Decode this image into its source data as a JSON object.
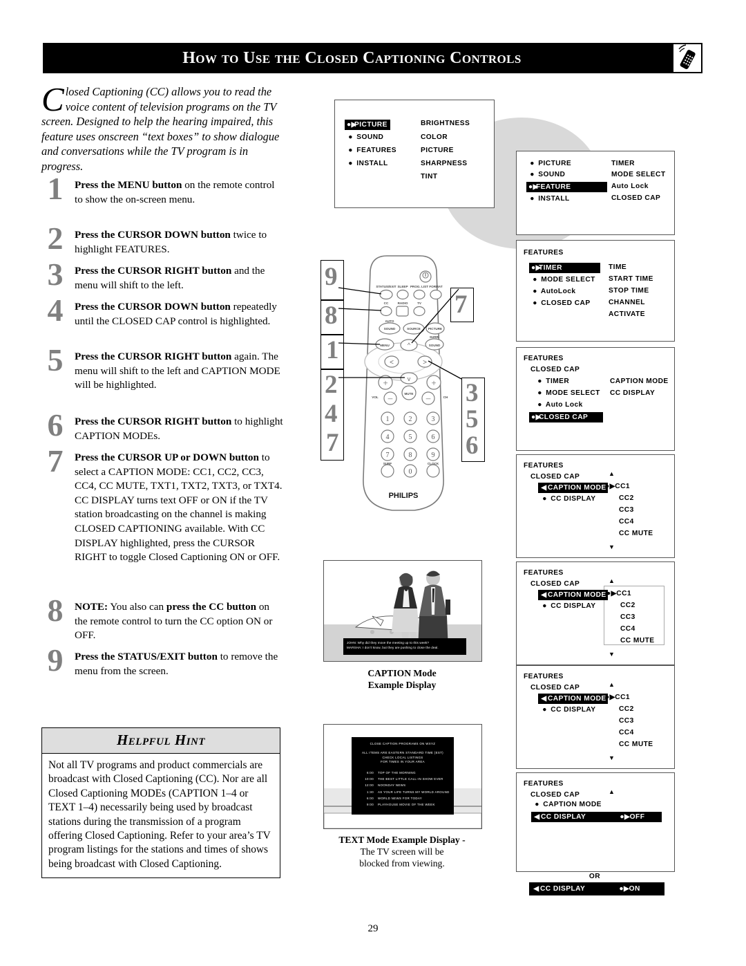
{
  "header": {
    "title": "How to Use the Closed Captioning Controls",
    "icon": "remote-control-icon"
  },
  "intro": {
    "dropcap": "C",
    "text": "losed Captioning (CC) allows you to read the voice content of television programs on the TV screen.  Designed to help the hearing impaired, this feature uses onscreen “text boxes” to show dialogue and conversations while the TV program is in progress."
  },
  "steps": [
    {
      "num": "1",
      "bold": "Press the MENU button",
      "rest": " on the remote control to show the on-screen menu."
    },
    {
      "num": "2",
      "bold": "Press the CURSOR DOWN button",
      "rest": " twice to highlight FEATURES."
    },
    {
      "num": "3",
      "bold": "Press the CURSOR RIGHT button",
      "rest": " and the menu will shift to the left."
    },
    {
      "num": "4",
      "bold": "Press the CURSOR DOWN button",
      "rest": " repeatedly until the CLOSED CAP control is highlighted."
    },
    {
      "num": "5",
      "bold": "Press the CURSOR RIGHT button",
      "rest": " again. The menu will shift to the left and CAPTION MODE will be highlighted."
    },
    {
      "num": "6",
      "bold": "Press the CURSOR RIGHT button",
      "rest": " to highlight CAPTION MODEs."
    },
    {
      "num": "7",
      "bold": "Press the CURSOR UP or DOWN button",
      "rest": " to select a CAPTION MODE: CC1, CC2, CC3, CC4, CC MUTE, TXT1, TXT2, TXT3, or TXT4.  CC DISPLAY turns text OFF or ON if the TV station broadcasting on the channel is making CLOSED CAPTIONING available. With CC DISPLAY highlighted, press the CURSOR RIGHT to toggle Closed Captioning ON or OFF."
    },
    {
      "num": "8",
      "bold": "NOTE:",
      "rest": " You also can ",
      "bold2": "press the CC button",
      "rest2": " on the remote control to turn the CC option ON or OFF."
    },
    {
      "num": "9",
      "bold": "Press the STATUS/EXIT button",
      "rest": " to remove the menu from the screen."
    }
  ],
  "hint": {
    "heading": "Helpful Hint",
    "body": "Not all TV programs and product commercials are broadcast with Closed Captioning (CC).  Nor are all Closed Captioning MODEs (CAPTION 1–4 or TEXT 1–4) necessarily being used by broadcast stations during the transmission of a program offering Closed Captioning.  Refer to your area’s TV program listings for the stations and times of shows being broadcast with Closed Captioning."
  },
  "page_number": "29",
  "menus": {
    "main": {
      "left": [
        "PICTURE",
        "SOUND",
        "FEATURES",
        "INSTALL"
      ],
      "highlight": "PICTURE",
      "right": [
        "BRIGHTNESS",
        "COLOR",
        "PICTURE",
        "SHARPNESS",
        "TINT"
      ]
    },
    "features_selected": {
      "left": [
        "PICTURE",
        "SOUND",
        "FEATURE",
        "INSTALL"
      ],
      "highlight": "FEATURE",
      "right": [
        "TIMER",
        "MODE SELECT",
        "Auto Lock",
        "CLOSED CAP"
      ]
    },
    "features_timer": {
      "title": "FEATURES",
      "left": [
        "TIMER",
        "MODE SELECT",
        "AutoLock",
        "CLOSED CAP"
      ],
      "highlight": "TIMER",
      "right": [
        "TIME",
        "START TIME",
        "STOP TIME",
        "CHANNEL",
        "ACTIVATE"
      ]
    },
    "closed_cap_selected": {
      "title": "FEATURES",
      "subtitle": "CLOSED CAP",
      "left": [
        "TIMER",
        "MODE SELECT",
        "Auto Lock",
        "CLOSED CAP"
      ],
      "highlight": "CLOSED CAP",
      "right": [
        "CAPTION MODE",
        "CC DISPLAY"
      ]
    },
    "caption_mode": {
      "title": "FEATURES",
      "subtitle": "CLOSED CAP",
      "left": [
        "CAPTION MODE",
        "CC DISPLAY"
      ],
      "highlight": "CAPTION MODE",
      "right": [
        "CC1",
        "CC2",
        "CC3",
        "CC4",
        "CC MUTE"
      ],
      "right_selected": "CC1",
      "scroll_up": "▲",
      "scroll_down": "▼"
    },
    "cc_display": {
      "title": "FEATURES",
      "subtitle": "CLOSED CAP",
      "left": [
        "CAPTION MODE",
        "CC DISPLAY"
      ],
      "highlight": "CC DISPLAY",
      "value_off": "OFF",
      "value_on": "ON",
      "or_label": "OR",
      "scroll_up": "▲"
    }
  },
  "remote": {
    "brand": "PHILIPS",
    "buttons": {
      "status_exit": "STATUS/EXIT",
      "sleep": "SLEEP",
      "prog_list": "PROG. LIST",
      "format": "FORMAT",
      "cc": "CC",
      "radio": "RADIO",
      "tv": "TV",
      "auto": "AUTO",
      "sound": "SOUND",
      "source": "SOURCE",
      "picture": "PICTURE",
      "surr": "SURR.",
      "surr_sound": "SOUND",
      "menu": "MENU",
      "mute": "MUTE",
      "vol": "VOL",
      "ch": "CH",
      "surf": "SURF",
      "clock": "CLOCK",
      "keypad": [
        "1",
        "2",
        "3",
        "4",
        "5",
        "6",
        "7",
        "8",
        "9",
        "0"
      ]
    },
    "callouts_left": [
      "9",
      "8",
      "1",
      "2",
      "4",
      "7"
    ],
    "callouts_right": [
      "7",
      "3",
      "5",
      "6"
    ]
  },
  "examples": {
    "caption": {
      "label_line1": "CAPTION Mode",
      "label_line2": "Example Display",
      "cc_line1": "JOHN: Why did they move  the meeting up to this week?",
      "cc_line2": "MARSHA: I don’t know, but they are pushing to close the deal."
    },
    "text": {
      "label_line1": "TEXT  Mode Example Display -",
      "label_line2": "The TV screen will be",
      "label_line3": "blocked from viewing.",
      "screen_title": "CLOSE CAPTION PROGRAMS ON WXYZ",
      "screen_note1": "ALL ITEMS ARE EASTERN STANDARD TIME (EST)",
      "screen_note2": "CHECK LOCAL LISTINGS",
      "screen_note3": "FOR TIMES IN YOUR AREA",
      "listings": [
        {
          "time": "6:00",
          "show": "TOP OF THE MORNING"
        },
        {
          "time": "10:00",
          "show": "THE BEST LITTLE CALL-IN SHOW EVER"
        },
        {
          "time": "12:00",
          "show": "NOONDAY NEWS"
        },
        {
          "time": "1:30",
          "show": "AS YOUR LIFE TURNS MY WORLD AROUND"
        },
        {
          "time": "6:00",
          "show": "WORLD NEWS FOR TODAY"
        },
        {
          "time": "9:00",
          "show": "PLAYHOUSE MOVIE OF THE WEEK"
        }
      ]
    }
  },
  "colors": {
    "header_bg": "#000000",
    "step_number": "#808080",
    "hint_head_bg": "#dedede",
    "bubble": "#d9d9d9"
  }
}
